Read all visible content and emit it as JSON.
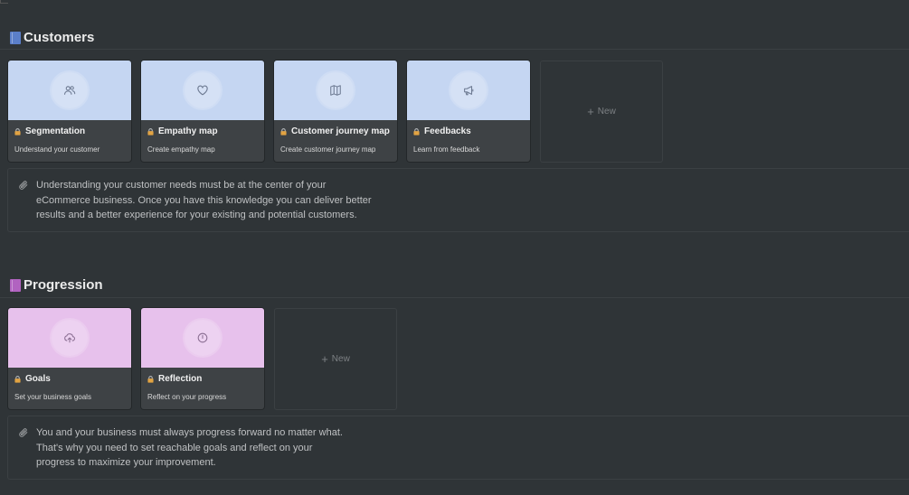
{
  "colors": {
    "background": "#2f3437",
    "customers_cover": "#c5d6f2",
    "progression_cover": "#e7c1ec",
    "customers_book": "#5b7fc9",
    "progression_book": "#b163c0",
    "lock": "#e2a342"
  },
  "sections": [
    {
      "title": "Customers",
      "icon": "blue-book-icon",
      "cards": [
        {
          "title": "Segmentation",
          "description": "Understand your customer",
          "icon": "people-icon"
        },
        {
          "title": "Empathy map",
          "description": "Create empathy map",
          "icon": "heart-icon"
        },
        {
          "title": "Customer journey map",
          "description": "Create customer journey map",
          "icon": "map-icon"
        },
        {
          "title": "Feedbacks",
          "description": "Learn from feedback",
          "icon": "megaphone-icon"
        }
      ],
      "new_label": "New",
      "callout_icon": "paperclip-icon",
      "callout_lines": [
        "Understanding your customer needs must be at the center of your",
        "eCommerce business. Once you have this knowledge you can deliver better",
        "results and a better experience for your existing and potential customers."
      ]
    },
    {
      "title": "Progression",
      "icon": "purple-book-icon",
      "cards": [
        {
          "title": "Goals",
          "description": "Set your business goals",
          "icon": "cloud-upload-icon"
        },
        {
          "title": "Reflection",
          "description": "Reflect on your progress",
          "icon": "clock-icon"
        }
      ],
      "new_label": "New",
      "callout_icon": "paperclip-icon",
      "callout_lines": [
        "You and your business must always progress forward no matter what.",
        "That's why you need to set reachable goals and reflect on your",
        "progress to maximize your improvement."
      ]
    }
  ]
}
